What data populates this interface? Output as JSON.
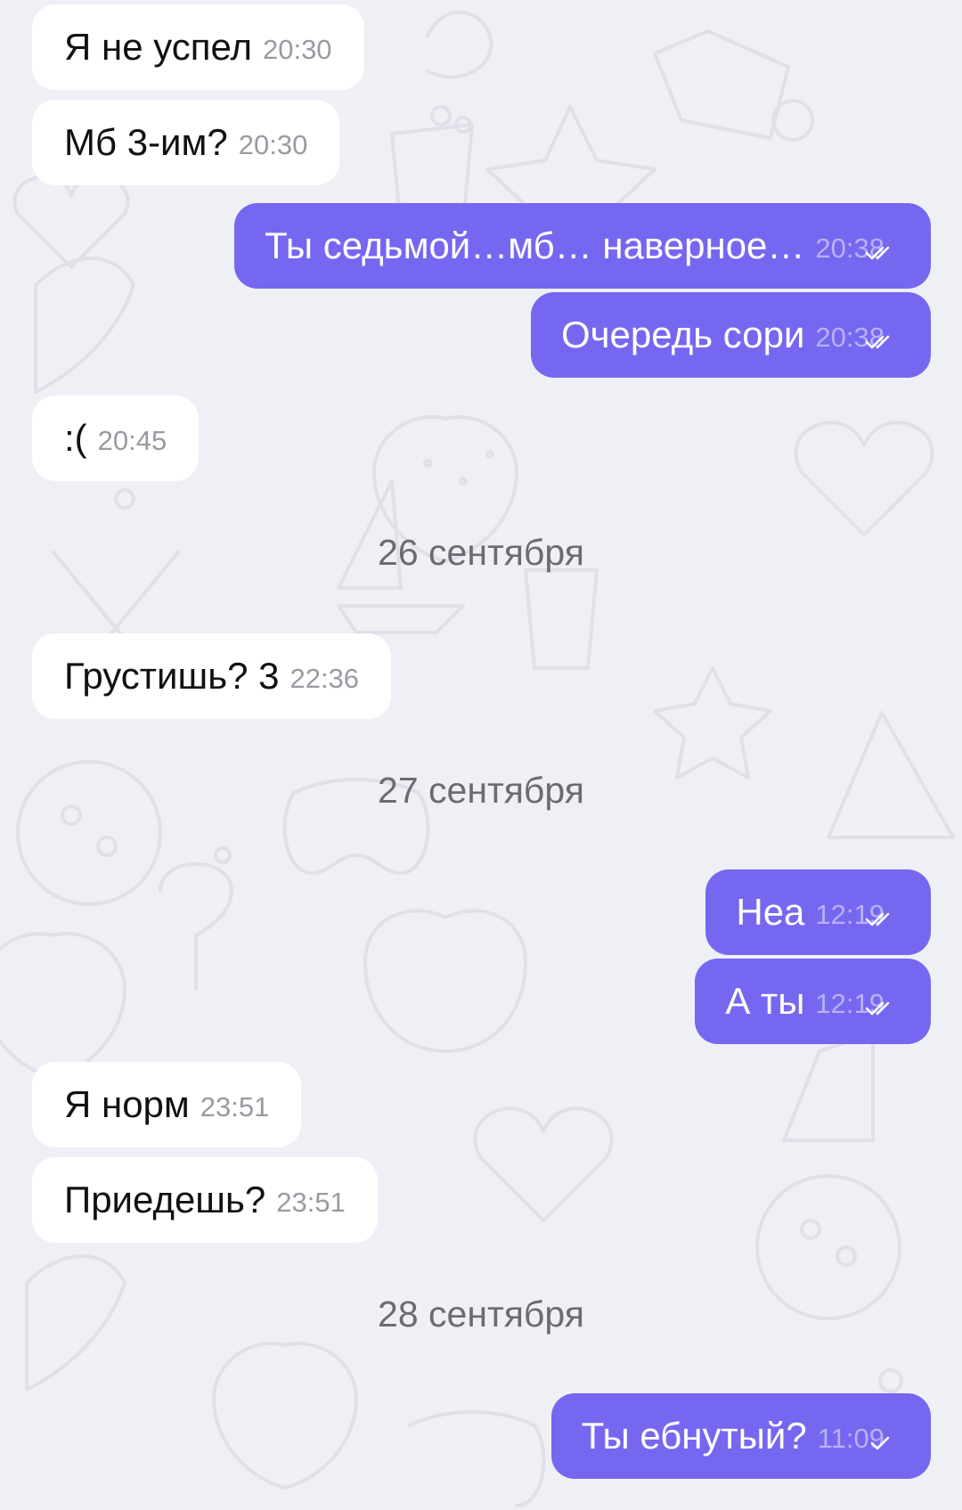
{
  "theme": {
    "background": "#eff0f5",
    "incoming_bubble": "#ffffff",
    "outgoing_bubble": "#7667f1",
    "pattern_color": "#dfe0e8"
  },
  "messages": [
    {
      "direction": "incoming",
      "text": "Я не успел",
      "time": "20:30"
    },
    {
      "direction": "incoming",
      "text": "Мб 3-им?",
      "time": "20:30"
    },
    {
      "direction": "outgoing",
      "text": "Ты седьмой…мб… наверное…",
      "time": "20:38",
      "status_icon": "double-check-icon"
    },
    {
      "direction": "outgoing",
      "text": "Очередь сори",
      "time": "20:38",
      "status_icon": "double-check-icon"
    },
    {
      "direction": "incoming",
      "text": ":(",
      "time": "20:45"
    },
    {
      "direction": "incoming",
      "text": "Грустишь? 3",
      "time": "22:36"
    },
    {
      "direction": "outgoing",
      "text": "Неа",
      "time": "12:19",
      "status_icon": "double-check-icon"
    },
    {
      "direction": "outgoing",
      "text": "А ты",
      "time": "12:19",
      "status_icon": "double-check-icon"
    },
    {
      "direction": "incoming",
      "text": "Я норм",
      "time": "23:51"
    },
    {
      "direction": "incoming",
      "text": "Приедешь?",
      "time": "23:51"
    },
    {
      "direction": "outgoing",
      "text": "Ты ебнутый?",
      "time": "11:09",
      "status_icon": "single-check-icon"
    }
  ],
  "date_separators": [
    "26 сентября",
    "27 сентября",
    "28 сентября"
  ]
}
